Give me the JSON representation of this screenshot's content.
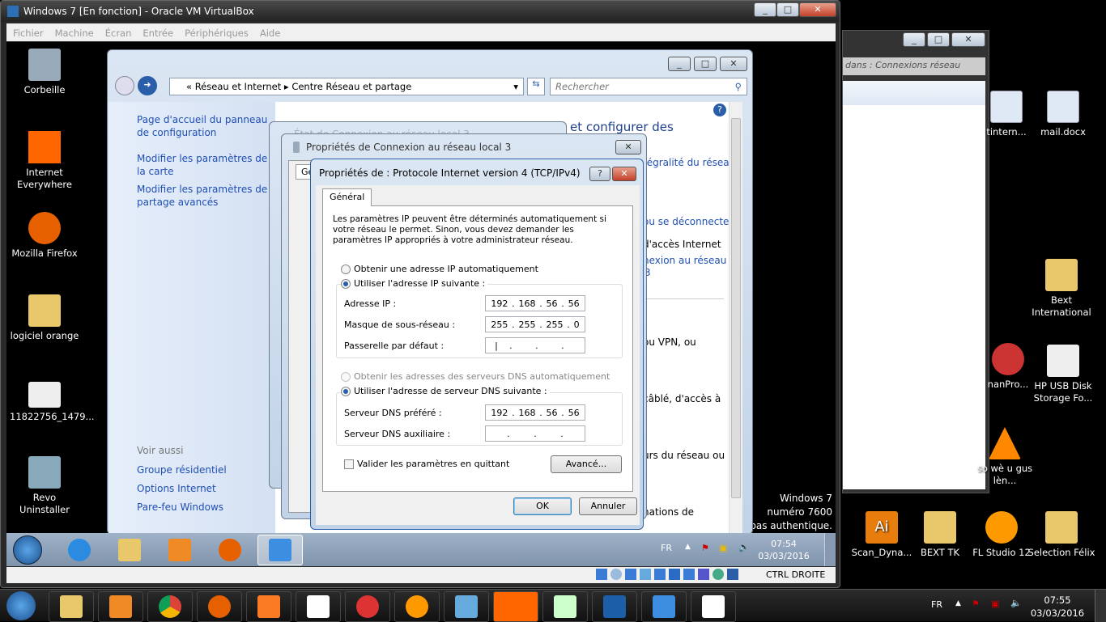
{
  "vbox": {
    "title": "Windows 7 [En fonction] - Oracle VM VirtualBox",
    "menu": [
      "Fichier",
      "Machine",
      "Écran",
      "Entrée",
      "Périphériques",
      "Aide"
    ],
    "status_key": "CTRL DROITE"
  },
  "guest_desktop": {
    "icons": [
      "Corbeille",
      "Internet Everywhere",
      "Mozilla Firefox",
      "logiciel orange",
      "11822756_1479...",
      "Revo Uninstaller"
    ],
    "watermark": [
      "Windows 7",
      "numéro 7600",
      "st pas authentique."
    ]
  },
  "control_panel": {
    "breadcrumb": [
      "Réseau et Internet",
      "Centre Réseau et partage"
    ],
    "search_placeholder": "Rechercher",
    "sidebar": [
      "Page d'accueil du panneau de configuration",
      "Modifier les paramètres de la carte",
      "Modifier les paramètres de partage avancés"
    ],
    "see_also_title": "Voir aussi",
    "see_also": [
      "Groupe résidentiel",
      "Options Internet",
      "Pare-feu Windows"
    ],
    "main_fragments": [
      "et configurer des",
      "tégralité du réseau",
      "ou se déconnecter",
      "d'accès Internet",
      "nexion au réseau",
      "3",
      "ou VPN, ou",
      "câblé, d'accès à",
      "urs du réseau ou",
      "nations de"
    ]
  },
  "status_dialog": {
    "title": "État de Connexion au réseau local 3"
  },
  "conn_props": {
    "title": "Propriétés de Connexion au réseau local 3",
    "tab": "Gé"
  },
  "ipv4": {
    "title": "Propriétés de : Protocole Internet version 4 (TCP/IPv4)",
    "tab": "Général",
    "intro": "Les paramètres IP peuvent être déterminés automatiquement si votre réseau le permet. Sinon, vous devez demander les paramètres IP appropriés à votre administrateur réseau.",
    "ip_auto": "Obtenir une adresse IP automatiquement",
    "ip_manual": "Utiliser l'adresse IP suivante :",
    "ip_label": "Adresse IP :",
    "ip": [
      "192",
      "168",
      "56",
      "56"
    ],
    "mask_label": "Masque de sous-réseau :",
    "mask": [
      "255",
      "255",
      "255",
      "0"
    ],
    "gw_label": "Passerelle par défaut :",
    "gw": [
      "",
      "",
      "",
      ""
    ],
    "dns_auto": "Obtenir les adresses des serveurs DNS automatiquement",
    "dns_manual": "Utiliser l'adresse de serveur DNS suivante :",
    "dns1_label": "Serveur DNS préféré :",
    "dns1": [
      "192",
      "168",
      "56",
      "56"
    ],
    "dns2_label": "Serveur DNS auxiliaire :",
    "dns2": [
      "",
      "",
      "",
      ""
    ],
    "validate": "Valider les paramètres en quittant",
    "advanced": "Avancé...",
    "ok": "OK",
    "cancel": "Annuler",
    "help": "?",
    "ip_mode": "manual",
    "dns_mode": "manual",
    "validate_checked": false
  },
  "guest_taskbar": {
    "lang": "FR",
    "time": "07:54",
    "date": "03/03/2016"
  },
  "host_explorer": {
    "search_placeholder": "dans : Connexions réseau"
  },
  "host_desktop": {
    "icons": [
      "tintern...",
      "mail.docx",
      "Bext International",
      "nanPro...",
      "HP USB Disk Storage Fo...",
      "so wè u gus lèn...",
      "Scan_Dyna...",
      "BEXT TK",
      "FL Studio 12",
      "Selection Félix"
    ]
  },
  "host_taskbar": {
    "lang": "FR",
    "time": "07:55",
    "date": "03/03/2016",
    "apps": [
      "explorer",
      "media-player",
      "chrome",
      "firefox",
      "xampp",
      "apps",
      "android",
      "network",
      "remote",
      "orange",
      "notepad",
      "virtualbox",
      "network-center",
      "paint"
    ]
  }
}
